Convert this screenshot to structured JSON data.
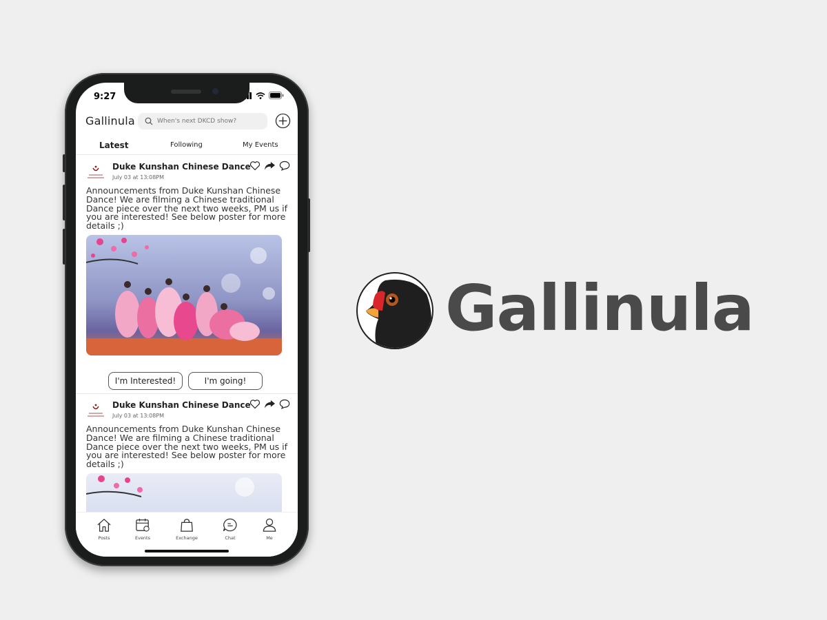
{
  "status": {
    "time": "9:27"
  },
  "app": {
    "name": "Gallinula"
  },
  "search": {
    "placeholder": "When's next DKCD show?"
  },
  "tabs": [
    {
      "label": "Latest",
      "active": true
    },
    {
      "label": "Following",
      "active": false
    },
    {
      "label": "My Events",
      "active": false
    }
  ],
  "posts": [
    {
      "author": "Duke Kunshan Chinese Dance",
      "time": "July 03 at 13:08PM",
      "text": "Announcements from Duke Kunshan Chinese Dance! We are filming a Chinese traditional Dance piece over the next two weeks, PM us if you are interested! See below poster for more details ;)",
      "buttons": {
        "interested": "I'm Interested!",
        "going": "I'm going!"
      }
    },
    {
      "author": "Duke Kunshan Chinese Dance",
      "time": "July 03 at 13:08PM",
      "text": "Announcements from Duke Kunshan Chinese Dance! We are filming a Chinese traditional Dance piece over the next two weeks, PM us if you are interested! See below poster for more details ;)"
    }
  ],
  "bottom_nav": [
    {
      "label": "Posts",
      "icon": "home-icon"
    },
    {
      "label": "Events",
      "icon": "calendar-icon"
    },
    {
      "label": "Exchange",
      "icon": "shopping-bag-icon"
    },
    {
      "label": "Chat",
      "icon": "chat-icon"
    },
    {
      "label": "Me",
      "icon": "user-icon"
    }
  ],
  "brand_display": {
    "wordmark": "Gallinula"
  },
  "colors": {
    "background": "#efefef",
    "phone_frame": "#1b1c1c",
    "wordmark": "#4a4a4a",
    "bird_beak": "#d8262b"
  }
}
